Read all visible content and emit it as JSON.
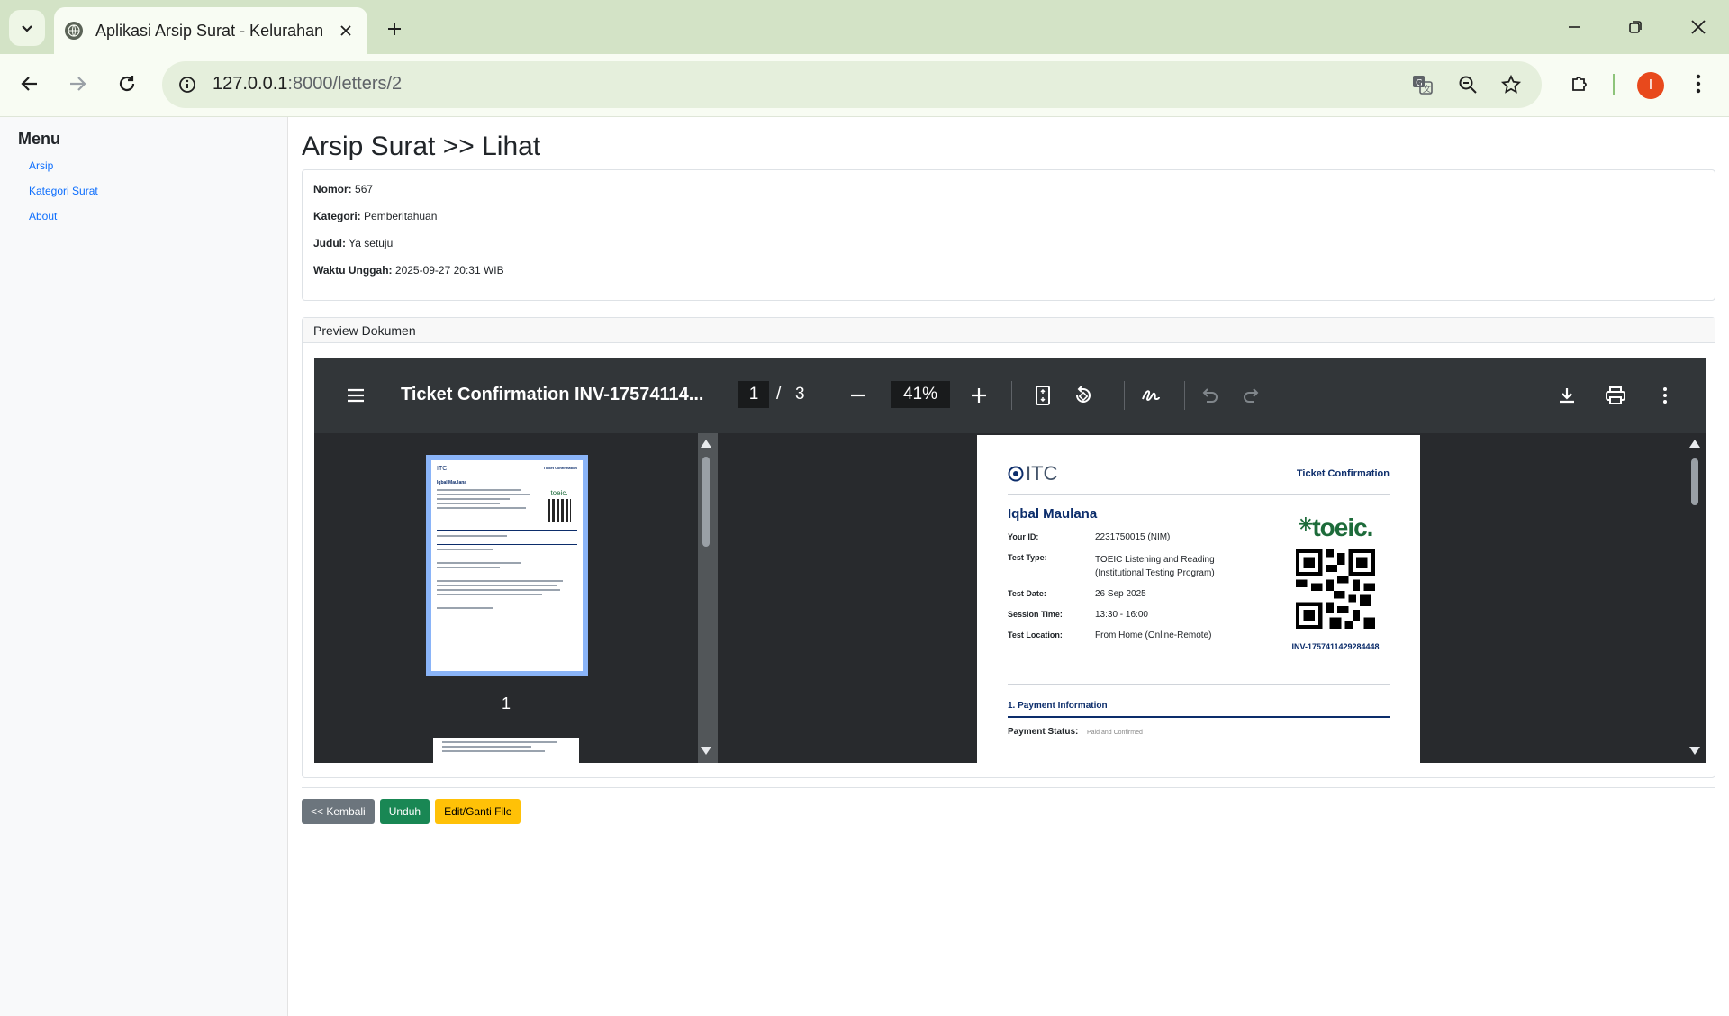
{
  "browser": {
    "tab_title": "Aplikasi Arsip Surat - Kelurahan",
    "url_host": "127.0.0.1",
    "url_rest": ":8000/letters/2",
    "profile_initial": "I"
  },
  "sidebar": {
    "title": "Menu",
    "items": [
      {
        "label": "Arsip"
      },
      {
        "label": "Kategori Surat"
      },
      {
        "label": "About"
      }
    ]
  },
  "page": {
    "title": "Arsip Surat >> Lihat",
    "fields": [
      {
        "label": "Nomor:",
        "value": "567"
      },
      {
        "label": "Kategori:",
        "value": "Pemberitahuan"
      },
      {
        "label": "Judul:",
        "value": "Ya setuju"
      },
      {
        "label": "Waktu Unggah:",
        "value": "2025-09-27 20:31 WIB"
      }
    ],
    "preview_heading": "Preview Dokumen"
  },
  "pdf_viewer": {
    "doc_title": "Ticket Confirmation INV-17574114...",
    "current_page": "1",
    "separator": "/",
    "total_pages": "3",
    "zoom": "41%",
    "thumb_label": "1"
  },
  "document": {
    "brand": "ITC",
    "header_right": "Ticket Confirmation",
    "name": "Iqbal Maulana",
    "rows": [
      {
        "label": "Your ID:",
        "value": "2231750015 (NIM)"
      },
      {
        "label": "Test Type:",
        "value": "TOEIC Listening and Reading (Institutional Testing Program)"
      },
      {
        "label": "Test Date:",
        "value": "26 Sep 2025"
      },
      {
        "label": "Session Time:",
        "value": "13:30 - 16:00"
      },
      {
        "label": "Test Location:",
        "value": "From Home (Online-Remote)"
      }
    ],
    "toeic_logo": "toeic.",
    "invoice": "INV-1757411429284448",
    "section1": "1. Payment Information",
    "payment_label": "Payment Status:",
    "payment_value": "Paid and Confirmed"
  },
  "buttons": {
    "back": "<< Kembali",
    "download": "Unduh",
    "edit": "Edit/Ganti File"
  },
  "colors": {
    "btn_back": "#6c757d",
    "btn_download": "#198754",
    "btn_edit": "#ffc107",
    "link": "#0d6efd",
    "doc_navy": "#0c2d6b",
    "toeic_green": "#1d6b3a"
  }
}
